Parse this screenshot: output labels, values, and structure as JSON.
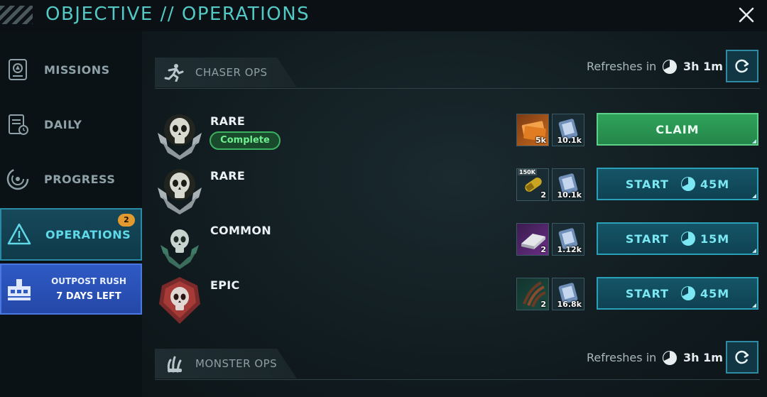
{
  "header": {
    "title": "OBJECTIVE // OPERATIONS"
  },
  "sidebar": {
    "items": [
      {
        "label": "MISSIONS",
        "icon": "missions-icon"
      },
      {
        "label": "DAILY",
        "icon": "daily-icon"
      },
      {
        "label": "PROGRESS",
        "icon": "progress-icon"
      },
      {
        "label": "OPERATIONS",
        "icon": "warning-icon",
        "badge": "2",
        "active": true
      }
    ],
    "event": {
      "line1": "OUTPOST RUSH",
      "line2": "7 DAYS LEFT"
    }
  },
  "sections": {
    "chaser": {
      "label": "CHASER OPS",
      "refresh_label": "Refreshes in",
      "refresh_time": "3h 1m"
    },
    "monster": {
      "label": "MONSTER OPS",
      "refresh_label": "Refreshes in",
      "refresh_time": "3h 1m"
    }
  },
  "ops": [
    {
      "rarity": "RARE",
      "status": "Complete",
      "rewards": [
        {
          "icon": "ticket-icon",
          "amount": "5k"
        },
        {
          "icon": "data-chip-icon",
          "amount": "10.1k"
        }
      ],
      "action": "CLAIM",
      "time": ""
    },
    {
      "rarity": "RARE",
      "status": "",
      "rewards": [
        {
          "icon": "ammo-icon",
          "amount": "2",
          "tag": "150K"
        },
        {
          "icon": "data-chip-icon",
          "amount": "10.1k"
        }
      ],
      "action": "START",
      "time": "45M"
    },
    {
      "rarity": "COMMON",
      "status": "",
      "rewards": [
        {
          "icon": "alloy-bar-icon",
          "amount": "2"
        },
        {
          "icon": "data-chip-icon",
          "amount": "1.12k"
        }
      ],
      "action": "START",
      "time": "15M"
    },
    {
      "rarity": "EPIC",
      "status": "",
      "rewards": [
        {
          "icon": "claw-icon",
          "amount": "2"
        },
        {
          "icon": "data-chip-icon",
          "amount": "16.8k"
        }
      ],
      "action": "START",
      "time": "45M"
    }
  ],
  "colors": {
    "accent": "#53c8c4",
    "claim": "#2fa25a",
    "start": "#145567",
    "badge": "#e29a2e",
    "event": "#2f5ac4"
  }
}
